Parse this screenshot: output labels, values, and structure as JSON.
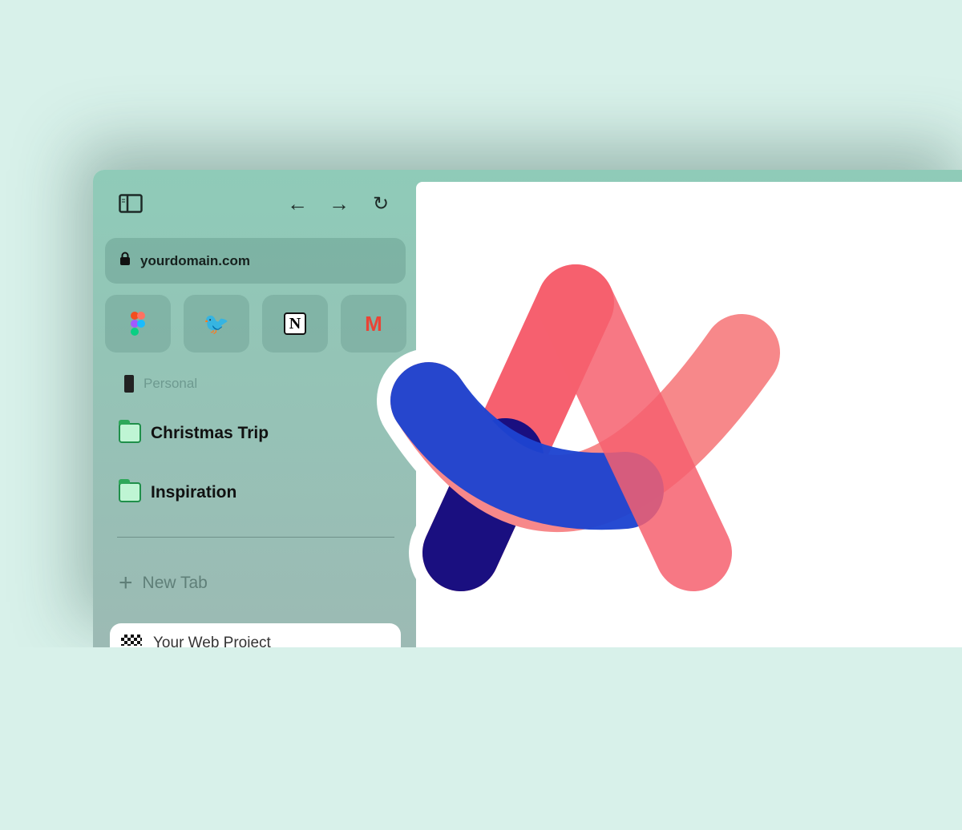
{
  "sidebar": {
    "url": "yourdomain.com",
    "favorites": [
      {
        "icon": "figma-icon"
      },
      {
        "icon": "twitter-icon"
      },
      {
        "icon": "notion-icon",
        "glyph": "N"
      },
      {
        "icon": "gmail-icon",
        "glyph": "M"
      }
    ],
    "space_label": "Personal",
    "folders": [
      {
        "label": "Christmas Trip"
      },
      {
        "label": "Inspiration"
      }
    ],
    "new_tab": "New Tab",
    "project_tab": "Your Web Project"
  },
  "colors": {
    "background": "#d8f1ea",
    "sidebar": "#8fcbb8",
    "logo_pink": "#f6606f",
    "logo_blue": "#1d44d0",
    "logo_navy": "#1a0f80"
  }
}
